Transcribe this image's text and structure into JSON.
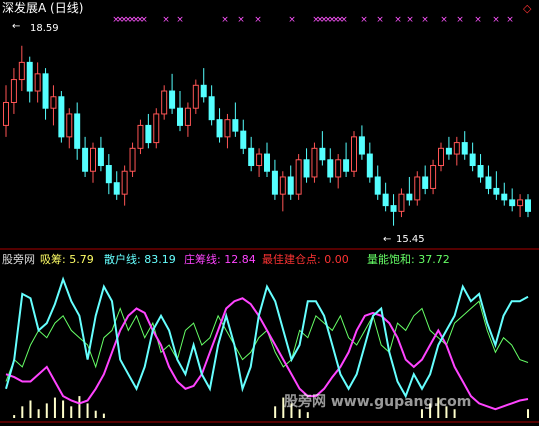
{
  "top_panel": {
    "title": "深发展A (日线)",
    "marker_glyph": "×",
    "max_price_label": "18.59",
    "min_price_label": "15.45",
    "arrow_glyph": "←",
    "diamond_glyph": "◇"
  },
  "bottom_panel": {
    "indicator_name": "股旁网",
    "legend": [
      {
        "label": "吸筹",
        "value": "5.79",
        "color": "#ffff66"
      },
      {
        "label": "散户线",
        "value": "83.19",
        "color": "#66ffff"
      },
      {
        "label": "庄筹线",
        "value": "12.84",
        "color": "#ff44ff"
      },
      {
        "label": "最佳建仓点",
        "value": "0.00",
        "color": "#ff3333"
      },
      {
        "label": "量能饱和",
        "value": "37.72",
        "color": "#66ff66"
      }
    ]
  },
  "watermark": "股旁网 www.gupang.com",
  "colors": {
    "up": "#ff5555",
    "down": "#55ffff",
    "retail_line": "#66ffff",
    "dealer_line": "#ff44ff",
    "volume_line": "#66ff66",
    "accumulate_bars": "#ffffcc",
    "markers": "#ff55ff",
    "divider": "#aa0000"
  },
  "chart_data": [
    {
      "type": "candlestick",
      "title": "深发展A (日线)",
      "series": [
        {
          "name": "price",
          "ohlc": [
            [
              17.2,
              17.9,
              17.0,
              17.6
            ],
            [
              17.6,
              18.2,
              17.4,
              18.0
            ],
            [
              18.0,
              18.59,
              17.8,
              18.3
            ],
            [
              18.3,
              18.4,
              17.6,
              17.8
            ],
            [
              17.8,
              18.3,
              17.6,
              18.1
            ],
            [
              18.1,
              18.2,
              17.3,
              17.5
            ],
            [
              17.5,
              17.9,
              17.2,
              17.7
            ],
            [
              17.7,
              17.8,
              16.9,
              17.0
            ],
            [
              17.0,
              17.5,
              16.8,
              17.4
            ],
            [
              17.4,
              17.6,
              16.6,
              16.8
            ],
            [
              16.8,
              17.0,
              16.3,
              16.4
            ],
            [
              16.4,
              16.9,
              16.2,
              16.8
            ],
            [
              16.8,
              17.0,
              16.4,
              16.5
            ],
            [
              16.5,
              16.7,
              16.0,
              16.2
            ],
            [
              16.2,
              16.4,
              15.9,
              16.0
            ],
            [
              16.0,
              16.5,
              15.8,
              16.4
            ],
            [
              16.4,
              16.9,
              16.3,
              16.8
            ],
            [
              16.8,
              17.3,
              16.7,
              17.2
            ],
            [
              17.2,
              17.4,
              16.8,
              16.9
            ],
            [
              16.9,
              17.5,
              16.8,
              17.4
            ],
            [
              17.4,
              17.9,
              17.3,
              17.8
            ],
            [
              17.8,
              18.1,
              17.4,
              17.5
            ],
            [
              17.5,
              17.8,
              17.1,
              17.2
            ],
            [
              17.2,
              17.6,
              17.0,
              17.5
            ],
            [
              17.5,
              18.0,
              17.4,
              17.9
            ],
            [
              17.9,
              18.2,
              17.6,
              17.7
            ],
            [
              17.7,
              17.9,
              17.2,
              17.3
            ],
            [
              17.3,
              17.5,
              16.9,
              17.0
            ],
            [
              17.0,
              17.4,
              16.8,
              17.3
            ],
            [
              17.3,
              17.6,
              17.0,
              17.1
            ],
            [
              17.1,
              17.3,
              16.7,
              16.8
            ],
            [
              16.8,
              17.0,
              16.4,
              16.5
            ],
            [
              16.5,
              16.8,
              16.3,
              16.7
            ],
            [
              16.7,
              16.9,
              16.3,
              16.4
            ],
            [
              16.4,
              16.6,
              15.9,
              16.0
            ],
            [
              16.0,
              16.4,
              15.7,
              16.3
            ],
            [
              16.3,
              16.5,
              15.9,
              16.0
            ],
            [
              16.0,
              16.7,
              15.9,
              16.6
            ],
            [
              16.6,
              16.8,
              16.2,
              16.3
            ],
            [
              16.3,
              16.9,
              16.2,
              16.8
            ],
            [
              16.8,
              17.1,
              16.5,
              16.6
            ],
            [
              16.6,
              16.8,
              16.2,
              16.3
            ],
            [
              16.3,
              16.7,
              16.1,
              16.6
            ],
            [
              16.6,
              16.9,
              16.3,
              16.4
            ],
            [
              16.4,
              17.1,
              16.3,
              17.0
            ],
            [
              17.0,
              17.2,
              16.6,
              16.7
            ],
            [
              16.7,
              16.9,
              16.2,
              16.3
            ],
            [
              16.3,
              16.5,
              15.9,
              16.0
            ],
            [
              16.0,
              16.2,
              15.7,
              15.8
            ],
            [
              15.8,
              16.0,
              15.45,
              15.7
            ],
            [
              15.7,
              16.1,
              15.6,
              16.0
            ],
            [
              16.0,
              16.3,
              15.8,
              15.9
            ],
            [
              15.9,
              16.4,
              15.8,
              16.3
            ],
            [
              16.3,
              16.5,
              16.0,
              16.1
            ],
            [
              16.1,
              16.6,
              16.0,
              16.5
            ],
            [
              16.5,
              16.9,
              16.4,
              16.8
            ],
            [
              16.8,
              17.0,
              16.6,
              16.7
            ],
            [
              16.7,
              17.0,
              16.5,
              16.9
            ],
            [
              16.9,
              17.1,
              16.6,
              16.7
            ],
            [
              16.7,
              16.9,
              16.4,
              16.5
            ],
            [
              16.5,
              16.7,
              16.2,
              16.3
            ],
            [
              16.3,
              16.5,
              16.0,
              16.1
            ],
            [
              16.1,
              16.4,
              15.9,
              16.0
            ],
            [
              16.0,
              16.2,
              15.8,
              15.9
            ],
            [
              15.9,
              16.1,
              15.7,
              15.8
            ],
            [
              15.8,
              16.0,
              15.6,
              15.9
            ],
            [
              15.9,
              16.0,
              15.6,
              15.7
            ]
          ]
        }
      ],
      "annotations": [
        {
          "label": "18.59",
          "type": "max"
        },
        {
          "label": "15.45",
          "type": "min"
        }
      ]
    },
    {
      "type": "line",
      "ylim": [
        0,
        100
      ],
      "series": [
        {
          "name": "散户线",
          "values": [
            20,
            40,
            85,
            82,
            60,
            65,
            78,
            95,
            80,
            70,
            40,
            70,
            90,
            80,
            40,
            30,
            20,
            35,
            60,
            70,
            60,
            40,
            30,
            50,
            30,
            20,
            50,
            70,
            50,
            20,
            35,
            70,
            90,
            80,
            60,
            40,
            50,
            80,
            80,
            70,
            50,
            30,
            20,
            30,
            50,
            70,
            75,
            45,
            25,
            15,
            30,
            20,
            30,
            50,
            60,
            70,
            90,
            80,
            85,
            65,
            50,
            70,
            80,
            80,
            83
          ]
        },
        {
          "name": "庄筹线",
          "values": [
            30,
            28,
            25,
            25,
            30,
            35,
            25,
            15,
            12,
            10,
            12,
            20,
            30,
            45,
            60,
            70,
            75,
            72,
            60,
            50,
            35,
            25,
            20,
            22,
            30,
            45,
            60,
            75,
            80,
            82,
            78,
            70,
            60,
            50,
            40,
            30,
            20,
            15,
            15,
            20,
            28,
            35,
            45,
            60,
            70,
            72,
            70,
            65,
            55,
            40,
            35,
            40,
            50,
            60,
            50,
            35,
            25,
            15,
            10,
            8,
            6,
            8,
            10,
            12,
            13
          ]
        },
        {
          "name": "量能饱和",
          "values": [
            25,
            40,
            35,
            50,
            60,
            55,
            65,
            70,
            60,
            55,
            50,
            35,
            55,
            60,
            75,
            60,
            70,
            55,
            65,
            45,
            50,
            40,
            60,
            65,
            50,
            55,
            70,
            60,
            50,
            40,
            45,
            55,
            60,
            45,
            35,
            40,
            60,
            55,
            70,
            65,
            60,
            70,
            55,
            50,
            60,
            70,
            50,
            45,
            65,
            60,
            70,
            75,
            60,
            55,
            50,
            65,
            70,
            75,
            80,
            60,
            45,
            55,
            50,
            40,
            38
          ]
        },
        {
          "name": "吸筹",
          "values": [
            0,
            2,
            8,
            12,
            6,
            10,
            14,
            12,
            8,
            15,
            10,
            5,
            3,
            0,
            0,
            0,
            0,
            0,
            0,
            0,
            0,
            0,
            0,
            0,
            0,
            0,
            0,
            0,
            0,
            0,
            0,
            0,
            0,
            8,
            14,
            10,
            6,
            4,
            0,
            0,
            0,
            0,
            0,
            0,
            0,
            0,
            0,
            0,
            0,
            0,
            0,
            6,
            10,
            14,
            8,
            6,
            0,
            0,
            0,
            0,
            0,
            0,
            0,
            0,
            6
          ]
        }
      ]
    }
  ]
}
